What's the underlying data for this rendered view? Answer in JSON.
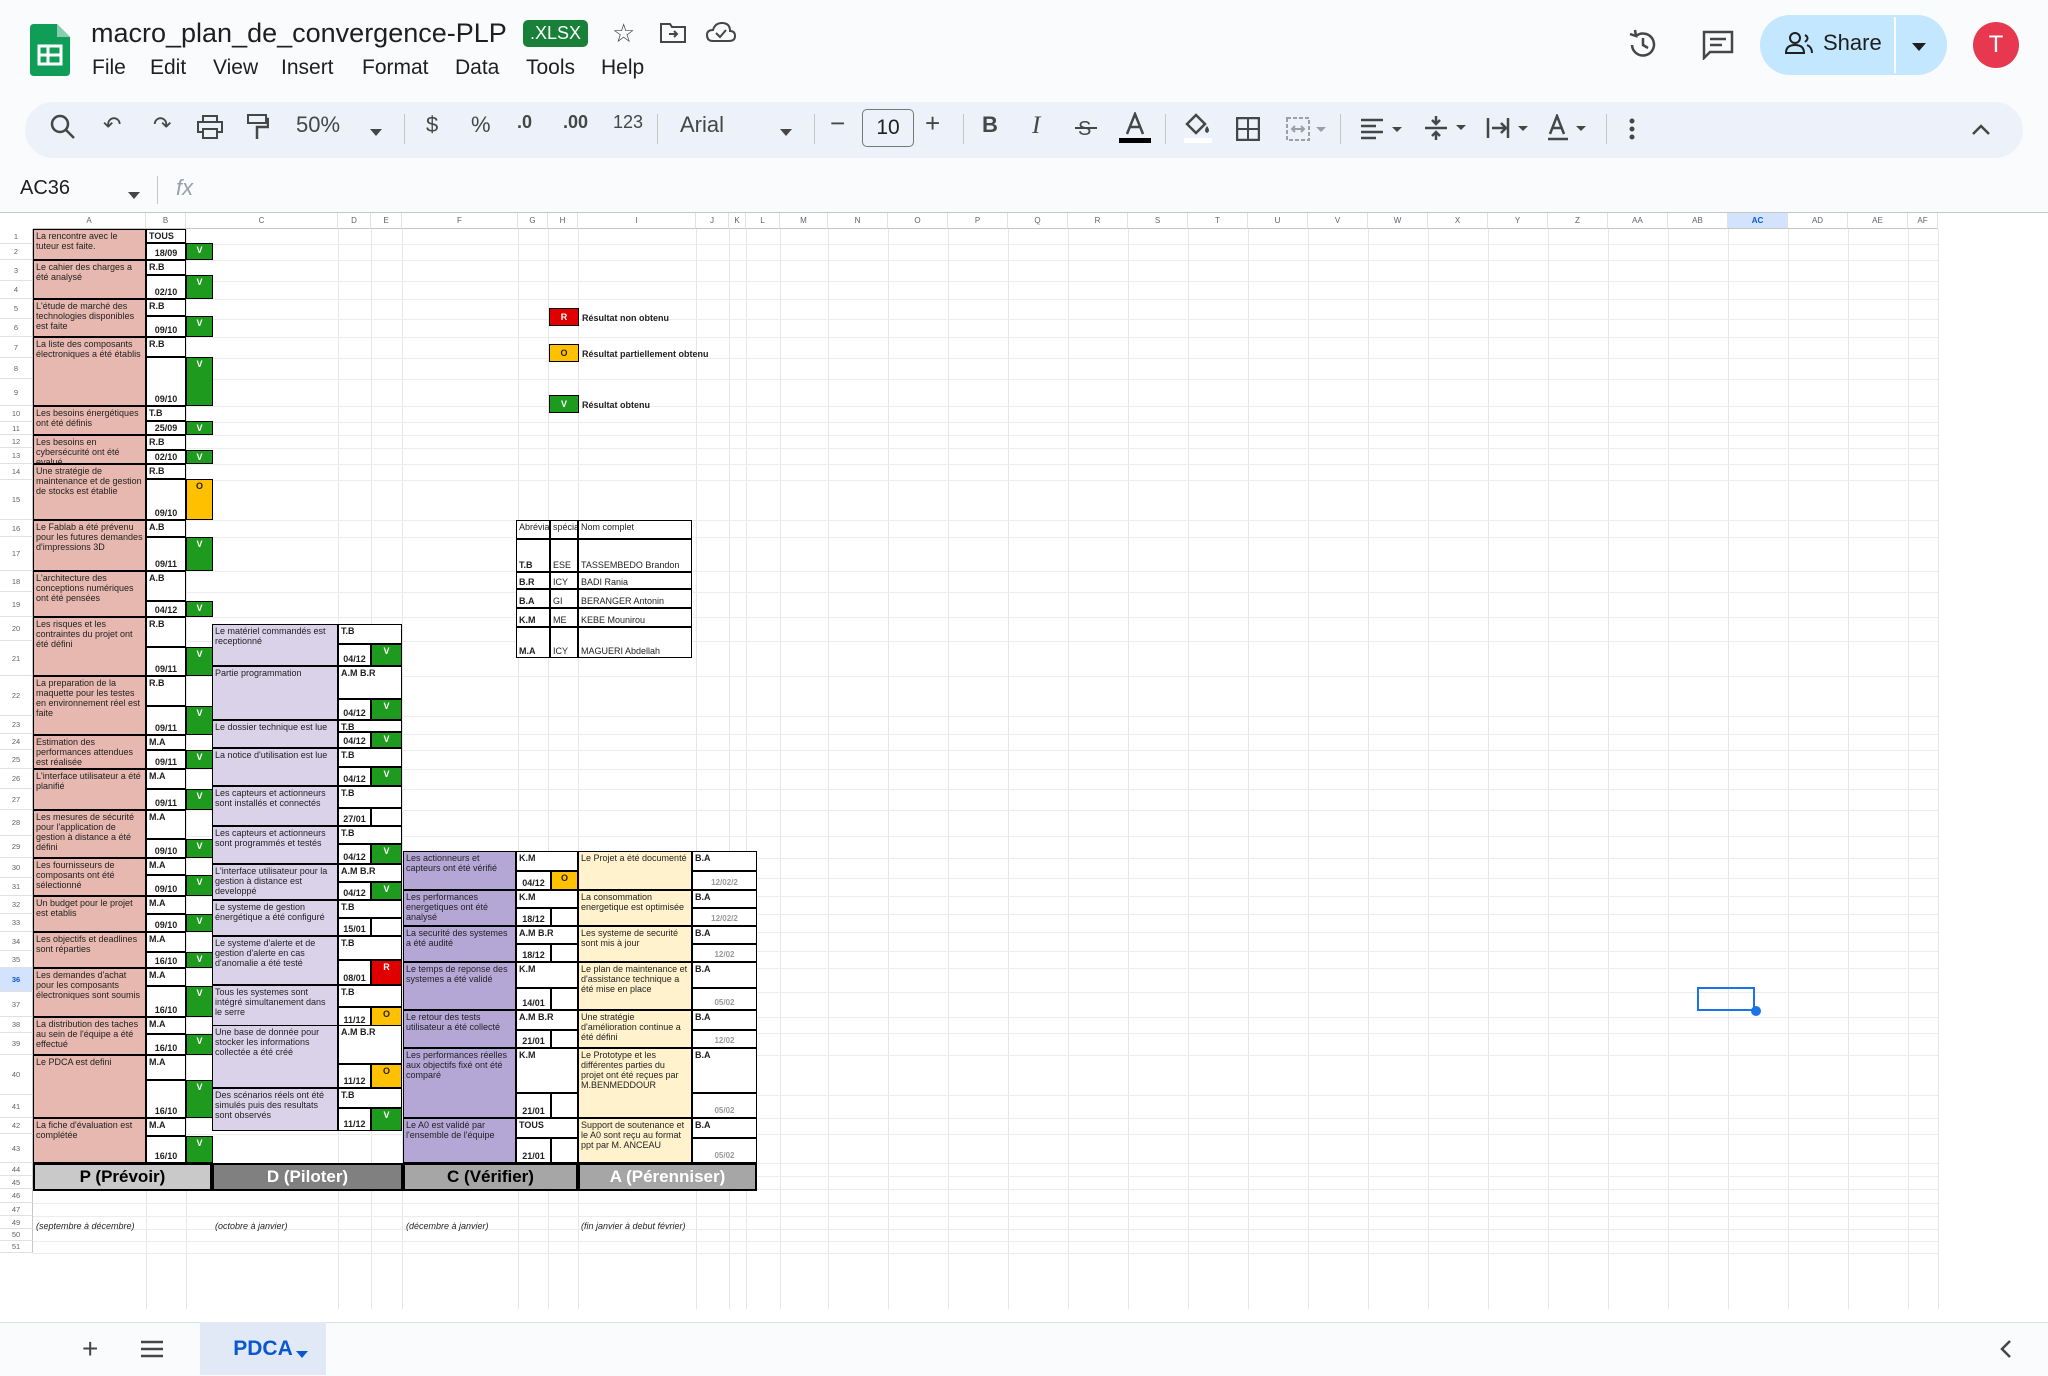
{
  "app": {
    "title": "macro_plan_de_convergence-PLP",
    "badge": ".XLSX",
    "menu": [
      "File",
      "Edit",
      "View",
      "Insert",
      "Format",
      "Data",
      "Tools",
      "Help"
    ],
    "share_label": "Share",
    "avatar_letter": "T"
  },
  "toolbar": {
    "zoom": "50%",
    "currency": "$",
    "percent": "%",
    "dec_decrease": ".0",
    "dec_increase": ".00",
    "number_format": "123",
    "font": "Arial",
    "font_size": "10",
    "bold": "B",
    "italic": "I",
    "minus": "−",
    "plus": "+"
  },
  "formula_bar": {
    "cell_ref": "AC36",
    "fx": "fx"
  },
  "columns": [
    "A",
    "B",
    "C",
    "D",
    "E",
    "F",
    "G",
    "H",
    "I",
    "J",
    "K",
    "L",
    "M",
    "N",
    "O",
    "P",
    "Q",
    "R",
    "S",
    "T",
    "U",
    "V",
    "W",
    "X",
    "Y",
    "Z",
    "AA",
    "AB",
    "AC",
    "AD",
    "AE",
    "AF"
  ],
  "rows": [
    "1",
    "2",
    "3",
    "4",
    "5",
    "6",
    "7",
    "8",
    "9",
    "10",
    "11",
    "12",
    "13",
    "14",
    "15",
    "16",
    "17",
    "18",
    "19",
    "20",
    "21",
    "22",
    "23",
    "24",
    "25",
    "26",
    "27",
    "28",
    "29",
    "30",
    "31",
    "32",
    "33",
    "34",
    "35",
    "36",
    "37",
    "38",
    "39",
    "40",
    "41",
    "42",
    "43",
    "44",
    "45",
    "46",
    "47",
    "49",
    "50",
    "51"
  ],
  "legend": [
    {
      "code": "R",
      "label": "Résultat  non obtenu"
    },
    {
      "code": "O",
      "label": "Résultat  partiellement obtenu"
    },
    {
      "code": "V",
      "label": "Résultat  obtenu"
    }
  ],
  "team_table": {
    "headers": [
      "Abrévia",
      "spécia",
      "Nom complet"
    ],
    "rows": [
      [
        "T.B",
        "ESE",
        "TASSEMBEDO Brandon"
      ],
      [
        "B.R",
        "ICY",
        "BADI Rania"
      ],
      [
        "B.A",
        "GI",
        "BERANGER Antonin"
      ],
      [
        "K.M",
        "ME",
        "KEBE Mounirou"
      ],
      [
        "M.A",
        "ICY",
        "MAGUERI Abdellah"
      ]
    ]
  },
  "plan": [
    {
      "text": "La rencontre avec le tuteur est faite.",
      "who": "TOUS",
      "date": "18/09",
      "status": "V"
    },
    {
      "text": "Le cahier des charges a été analysé",
      "who": "R.B",
      "date": "02/10",
      "status": "V"
    },
    {
      "text": "L'étude de marché des technologies disponibles est faite",
      "who": "R.B",
      "date": "09/10",
      "status": "V"
    },
    {
      "text": "La liste des composants électroniques a été établis",
      "who": "R.B",
      "date": "09/10",
      "status": "V"
    },
    {
      "text": "Les besoins énergétiques ont été définis",
      "who": "T.B",
      "date": "25/09",
      "status": "V"
    },
    {
      "text": "Les besoins en cybersécurité ont été evalué",
      "who": "R.B",
      "date": "02/10",
      "status": "V"
    },
    {
      "text": "Une stratégie de maintenance et de gestion de stocks est établie",
      "who": "R.B",
      "date": "09/10",
      "status": "O"
    },
    {
      "text": "Le Fablab a été prévenu pour les futures demandes d'impressions 3D",
      "who": "A.B",
      "date": "09/11",
      "status": "V"
    },
    {
      "text": "L'architecture des conceptions numériques ont été pensées",
      "who": "A.B",
      "date": "04/12",
      "status": "V"
    },
    {
      "text": "Les risques et les contraintes du projet ont été défini",
      "who": "R.B",
      "date": "09/11",
      "status": "V"
    },
    {
      "text": "La preparation de la maquette pour les testes en environnement réel est faite",
      "who": "R.B",
      "date": "09/11",
      "status": "V"
    },
    {
      "text": "Estimation des performances attendues est réalisée",
      "who": "M.A",
      "date": "09/11",
      "status": "V"
    },
    {
      "text": "L'interface utilisateur a été planifié",
      "who": "M.A",
      "date": "09/11",
      "status": "V"
    },
    {
      "text": "Les mesures de sécurité pour l'application de gestion à distance a été défini",
      "who": "M.A",
      "date": "09/10",
      "status": "V"
    },
    {
      "text": "Les fournisseurs de composants ont été sélectionné",
      "who": "M.A",
      "date": "09/10",
      "status": "V"
    },
    {
      "text": "Un budget pour le projet est etablis",
      "who": "M.A",
      "date": "09/10",
      "status": "V"
    },
    {
      "text": "Les objectifs et deadlines sont réparties",
      "who": "M.A",
      "date": "16/10",
      "status": "V"
    },
    {
      "text": "Les demandes d'achat pour les composants électroniques sont soumis",
      "who": "M.A",
      "date": "16/10",
      "status": "V"
    },
    {
      "text": "La distribution des taches au sein de l'équipe a été effectué",
      "who": "M.A",
      "date": "16/10",
      "status": "V"
    },
    {
      "text": "Le PDCA est defini",
      "who": "M.A",
      "date": "16/10",
      "status": "V"
    },
    {
      "text": "La fiche d'évaluation est complétée",
      "who": "M.A",
      "date": "16/10",
      "status": "V"
    }
  ],
  "do": [
    {
      "text": "Le matériel commandés est receptionné",
      "who": "T.B",
      "date": "04/12",
      "status": "V"
    },
    {
      "text": "Partie programmation",
      "who": "A.M  B.R",
      "date": "04/12",
      "status": "V"
    },
    {
      "text": "Le dossier technique est lue",
      "who": "T.B",
      "date": "04/12",
      "status": "V"
    },
    {
      "text": "La notice d'utilisation est lue",
      "who": "T.B",
      "date": "04/12",
      "status": "V"
    },
    {
      "text": "Les capteurs et actionneurs sont installés et connectés",
      "who": "T.B",
      "date": "27/01",
      "status": ""
    },
    {
      "text": "Les capteurs et actionneurs sont programmés et testés",
      "who": "T.B",
      "date": "04/12",
      "status": "V"
    },
    {
      "text": "L'interface utilisateur pour la gestion à distance est developpé",
      "who": "A.M  B.R",
      "date": "04/12",
      "status": "V"
    },
    {
      "text": "Le systeme de gestion énergétique a été configuré",
      "who": "T.B",
      "date": "15/01",
      "status": ""
    },
    {
      "text": "Le systeme d'alerte et de gestion d'alerte en cas d'anomalie a été testé",
      "who": "T.B",
      "date": "08/01",
      "status": "R"
    },
    {
      "text": "Tous les systemes sont intégré simultanement dans le serre",
      "who": "T.B",
      "date": "11/12",
      "status": "O"
    },
    {
      "text": "Une base de donnée pour stocker les informations collectée a été créé",
      "who": "A.M  B.R",
      "date": "11/12",
      "status": "O"
    },
    {
      "text": "Des scénarios réels ont été simulés puis des resultats sont observés",
      "who": "T.B",
      "date": "11/12",
      "status": "V"
    }
  ],
  "check": [
    {
      "text": "Les actionneurs et capteurs ont été vérifié",
      "who": "K.M",
      "date": "04/12",
      "status": "O"
    },
    {
      "text": "Les performances energetiques ont été analysé",
      "who": "K.M",
      "date": "18/12",
      "status": ""
    },
    {
      "text": "La securité des systemes a été audité",
      "who": "A.M  B.R",
      "date": "18/12",
      "status": ""
    },
    {
      "text": "Le temps de reponse des systemes a été validé",
      "who": "K.M",
      "date": "14/01",
      "status": ""
    },
    {
      "text": "Le retour des tests utilisateur a été collecté",
      "who": "A.M  B.R",
      "date": "21/01",
      "status": ""
    },
    {
      "text": "Les performances réelles aux objectifs fixé ont été comparé",
      "who": "K.M",
      "date": "21/01",
      "status": ""
    },
    {
      "text": "Le A0 est validé par l'ensemble de l'équipe",
      "who": "TOUS",
      "date": "21/01",
      "status": ""
    }
  ],
  "act": [
    {
      "text": "Le Projet a été documenté",
      "who": "B.A",
      "date": "12/02/2"
    },
    {
      "text": "La consommation energetique est optimisée",
      "who": "B.A",
      "date": "12/02/2"
    },
    {
      "text": "Les systeme de securité sont mis à jour",
      "who": "B.A",
      "date": "12/02"
    },
    {
      "text": "Le plan de maintenance et d'assistance technique a été mise en place",
      "who": "B.A",
      "date": "05/02"
    },
    {
      "text": "Une stratégie d'amélioration continue a été défini",
      "who": "B.A",
      "date": "12/02"
    },
    {
      "text": "Le Prototype et les différentes parties du projet ont été reçues par M.BENMEDDOUR",
      "who": "B.A",
      "date": "05/02"
    },
    {
      "text": "Support de soutenance et le A0 sont reçu au format ppt par M. ANCEAU",
      "who": "B.A",
      "date": "05/02"
    }
  ],
  "phases": [
    {
      "label": "P (Prévoir)",
      "note": "(septembre à décembre)"
    },
    {
      "label": "D (Piloter)",
      "note": "(octobre à janvier)"
    },
    {
      "label": "C (Vérifier)",
      "note": "(décembre à janvier)"
    },
    {
      "label": "A (Pérenniser)",
      "note": "(fin janvier à debut février)"
    }
  ],
  "sheet_tab": "PDCA",
  "colors": {
    "pink": "#e6b8af",
    "lavender": "#d9d2e9",
    "purple": "#b4a7d6",
    "yellow": "#fff2cc",
    "green": "#1e9b1e",
    "orange": "#ffc000",
    "red": "#e00000"
  }
}
